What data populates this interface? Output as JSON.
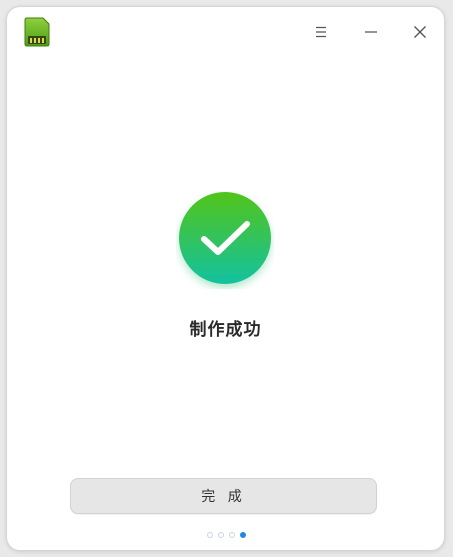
{
  "titlebar": {
    "app_icon": "sd-card-icon",
    "menu_icon": "menu-icon",
    "minimize_icon": "minimize-icon",
    "close_icon": "close-icon"
  },
  "main": {
    "status_icon": "checkmark-icon",
    "status_text": "制作成功",
    "done_button_label": "完 成"
  },
  "pager": {
    "total": 4,
    "active_index": 3
  },
  "colors": {
    "success_gradient_top": "#52c41a",
    "success_gradient_bottom": "#13c2a0",
    "app_icon_green": "#6ab51e",
    "active_dot": "#1e88e5"
  }
}
